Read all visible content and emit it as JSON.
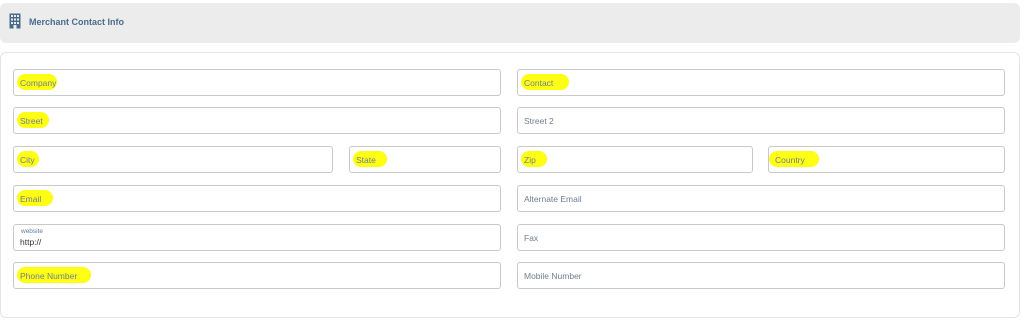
{
  "header": {
    "title": "Merchant Contact Info",
    "icon": "building-icon"
  },
  "colors": {
    "header_bg": "#ececec",
    "title": "#4a6c8c",
    "highlight": "#ffff00",
    "border": "#c9c9c9"
  },
  "fields": {
    "company": "Company",
    "contact": "Contact",
    "street": "Street",
    "street2": "Street 2",
    "city": "City",
    "state": "State",
    "zip": "Zip",
    "country": "Country",
    "email": "Email",
    "alternate_email": "Alternate Email",
    "website_label": "website",
    "website_value": "http://",
    "fax": "Fax",
    "phone": "Phone Number",
    "mobile": "Mobile Number"
  }
}
